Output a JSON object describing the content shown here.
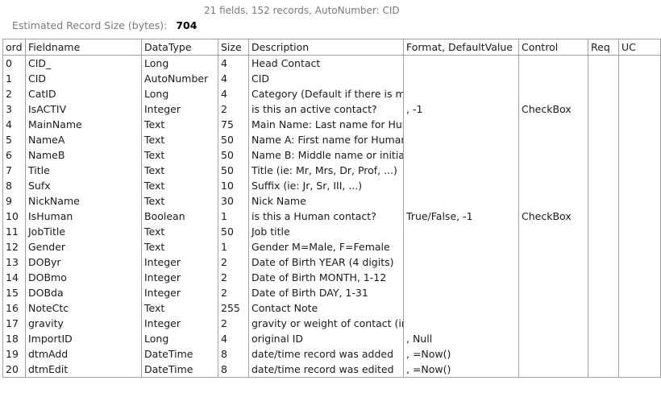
{
  "header": {
    "summary": "21 fields, 152 records, AutoNumber: CID",
    "size_label": "Estimated Record Size (bytes):",
    "size_value": "704"
  },
  "columns": [
    "ord",
    "Fieldname",
    "DataType",
    "Size",
    "Description",
    "Format, DefaultValue",
    "Control",
    "Req",
    "UC"
  ],
  "rows": [
    [
      "0",
      "CID_",
      "Long",
      "4",
      "Head Contact",
      "",
      "",
      "",
      ""
    ],
    [
      "1",
      "CID",
      "AutoNumber",
      "4",
      "CID",
      "",
      "",
      "",
      ""
    ],
    [
      "2",
      "CatID",
      "Long",
      "4",
      "Category (Default if there is m",
      "",
      "",
      "",
      ""
    ],
    [
      "3",
      "IsACTIV",
      "Integer",
      "2",
      "is this an active contact?",
      ", -1",
      "CheckBox",
      "",
      ""
    ],
    [
      "4",
      "MainName",
      "Text",
      "75",
      "Main Name: Last name for Hun",
      "",
      "",
      "",
      ""
    ],
    [
      "5",
      "NameA",
      "Text",
      "50",
      "Name A: First name for Human",
      "",
      "",
      "",
      ""
    ],
    [
      "6",
      "NameB",
      "Text",
      "50",
      "Name B: Middle name or initia",
      "",
      "",
      "",
      ""
    ],
    [
      "7",
      "Title",
      "Text",
      "50",
      "Title (ie: Mr, Mrs, Dr, Prof, ...)",
      "",
      "",
      "",
      ""
    ],
    [
      "8",
      "Sufx",
      "Text",
      "10",
      "Suffix (ie: Jr, Sr, III, ...)",
      "",
      "",
      "",
      ""
    ],
    [
      "9",
      "NickName",
      "Text",
      "30",
      "Nick Name",
      "",
      "",
      "",
      ""
    ],
    [
      "10",
      "IsHuman",
      "Boolean",
      "1",
      "is this a Human contact?",
      "True/False, -1",
      "CheckBox",
      "",
      ""
    ],
    [
      "11",
      "JobTitle",
      "Text",
      "50",
      "Job title",
      "",
      "",
      "",
      ""
    ],
    [
      "12",
      "Gender",
      "Text",
      "1",
      "Gender M=Male, F=Female",
      "",
      "",
      "",
      ""
    ],
    [
      "13",
      "DOByr",
      "Integer",
      "2",
      "Date of Birth YEAR (4 digits)",
      "",
      "",
      "",
      ""
    ],
    [
      "14",
      "DOBmo",
      "Integer",
      "2",
      "Date of Birth MONTH, 1-12",
      "",
      "",
      "",
      ""
    ],
    [
      "15",
      "DOBda",
      "Integer",
      "2",
      "Date of Birth DAY, 1-31",
      "",
      "",
      "",
      ""
    ],
    [
      "16",
      "NoteCtc",
      "Text",
      "255",
      "Contact Note",
      "",
      "",
      "",
      ""
    ],
    [
      "17",
      "gravity",
      "Integer",
      "2",
      "gravity or weight of contact (in",
      "",
      "",
      "",
      ""
    ],
    [
      "18",
      "ImportID",
      "Long",
      "4",
      "original ID",
      ", Null",
      "",
      "",
      ""
    ],
    [
      "19",
      "dtmAdd",
      "DateTime",
      "8",
      "date/time record was added",
      ", =Now()",
      "",
      "",
      ""
    ],
    [
      "20",
      "dtmEdit",
      "DateTime",
      "8",
      "date/time record was edited",
      ", =Now()",
      "",
      "",
      ""
    ]
  ]
}
